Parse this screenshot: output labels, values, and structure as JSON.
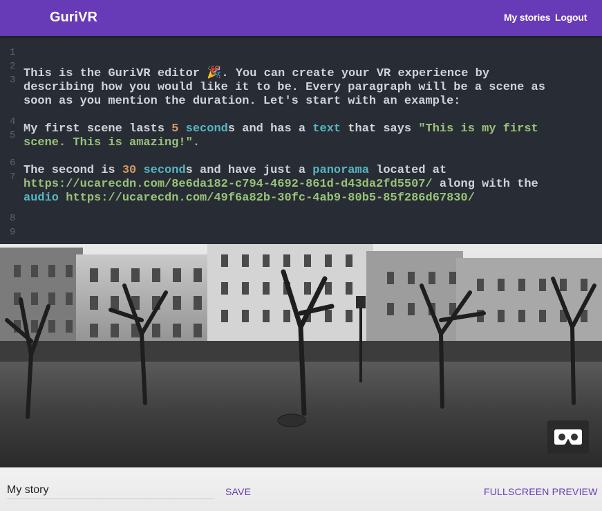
{
  "header": {
    "brand": "GuriVR",
    "nav": {
      "my_stories": "My stories",
      "logout": "Logout"
    },
    "color": "#673ab7"
  },
  "editor": {
    "line_numbers": [
      "1",
      "2",
      "3",
      "4",
      "5",
      "6",
      "7",
      "8",
      "9"
    ],
    "lines": {
      "l3a": "This is the GuriVR editor 🎉. You can create your VR experience by",
      "l3b": "describing how you would like it to be. Every paragraph will be a scene as",
      "l3c": "soon as you mention the duration. Let's start with an example:",
      "l5a_1": "My first scene lasts ",
      "l5a_2": "5",
      "l5a_3": " ",
      "l5a_4": "second",
      "l5a_5": "s and has a ",
      "l5a_6": "text",
      "l5a_7": " that says ",
      "l5a_8": "\"This is my first",
      "l5b_1": "scene. This is amazing!",
      "l5b_2": "\".",
      "l7a_1": "The second is ",
      "l7a_2": "30",
      "l7a_3": " ",
      "l7a_4": "second",
      "l7a_5": "s and have just a ",
      "l7a_6": "panorama",
      "l7a_7": " located at",
      "l7b_1": "https://ucarecdn.com/8e6da182-c794-4692-861d-d43da2fd5507/",
      "l7b_2": " along with the",
      "l7c_1": "audio",
      "l7c_2": " ",
      "l7c_3": "https://ucarecdn.com/49f6a82b-30fc-4ab9-80b5-85f286d67830/"
    },
    "colors": {
      "background": "#282c34",
      "number": "#d19a66",
      "keyword": "#56b6c2",
      "string": "#98c379"
    }
  },
  "preview": {
    "vr_button_icon": "cardboard-vr-icon"
  },
  "footer": {
    "story_name_value": "My story",
    "save_label": "SAVE",
    "fullscreen_label": "FULLSCREEN PREVIEW"
  }
}
